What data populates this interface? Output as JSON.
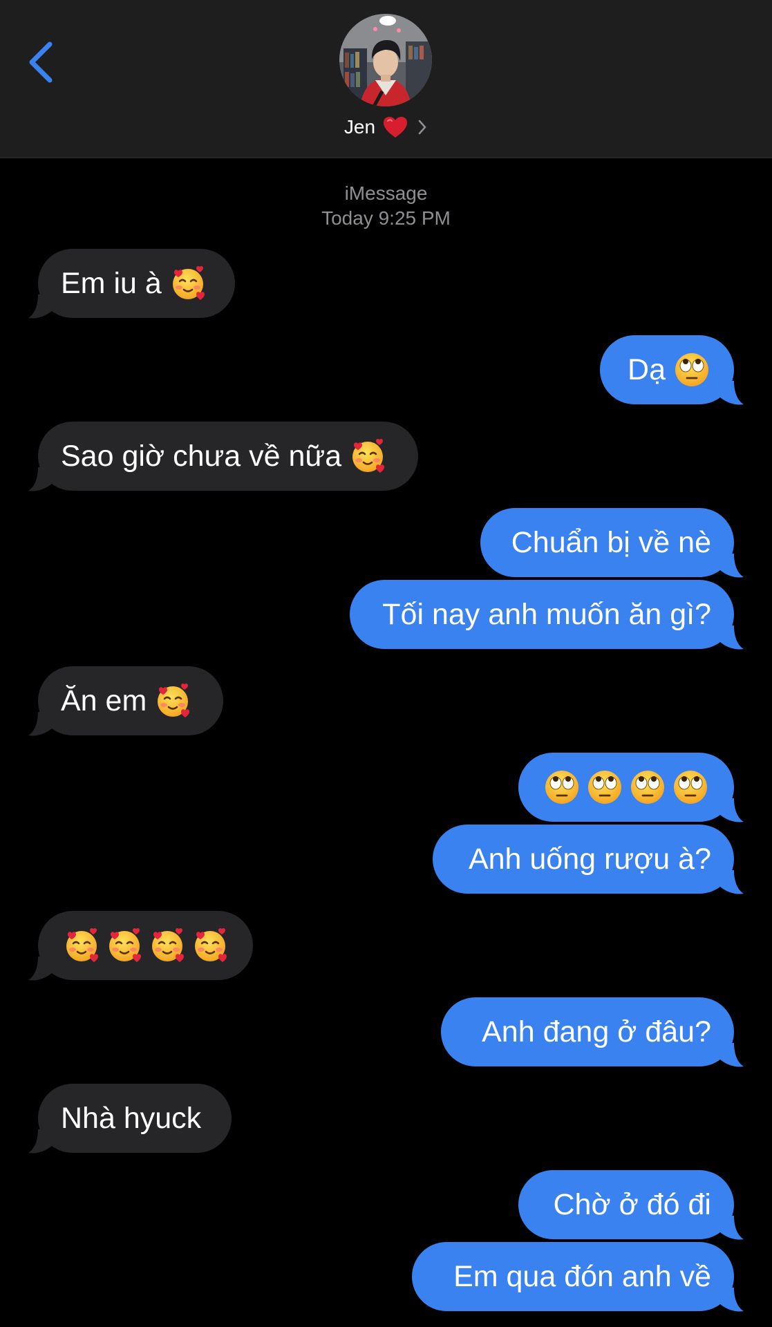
{
  "header": {
    "contact_name": "Jen",
    "heart_icon": "red-heart-icon",
    "chevron_icon": "chevron-right-icon",
    "back_icon": "chevron-left-icon",
    "accent_color": "#3b82f1"
  },
  "thread": {
    "service": "iMessage",
    "timestamp": "Today 9:25 PM"
  },
  "messages": [
    {
      "direction": "incoming",
      "text": "Em iu à",
      "emoji": [
        "smiling-face-with-hearts"
      ]
    },
    {
      "direction": "outgoing",
      "text": "Dạ",
      "emoji": [
        "face-with-rolling-eyes"
      ]
    },
    {
      "direction": "incoming",
      "text": "Sao giờ chưa về nữa",
      "emoji": [
        "smiling-face-with-hearts"
      ]
    },
    {
      "direction": "outgoing",
      "text": "Chuẩn bị về nè",
      "emoji": []
    },
    {
      "direction": "outgoing",
      "text": "Tối nay anh muốn ăn gì?",
      "emoji": []
    },
    {
      "direction": "incoming",
      "text": "Ăn em",
      "emoji": [
        "smiling-face-with-hearts"
      ]
    },
    {
      "direction": "outgoing",
      "text": "",
      "emoji": [
        "face-with-rolling-eyes",
        "face-with-rolling-eyes",
        "face-with-rolling-eyes",
        "face-with-rolling-eyes"
      ]
    },
    {
      "direction": "outgoing",
      "text": "Anh uống rượu à?",
      "emoji": []
    },
    {
      "direction": "incoming",
      "text": "",
      "emoji": [
        "smiling-face-with-hearts",
        "smiling-face-with-hearts",
        "smiling-face-with-hearts",
        "smiling-face-with-hearts"
      ]
    },
    {
      "direction": "outgoing",
      "text": "Anh đang ở đâu?",
      "emoji": []
    },
    {
      "direction": "incoming",
      "text": "Nhà hyuck",
      "emoji": []
    },
    {
      "direction": "outgoing",
      "text": "Chờ ở đó đi",
      "emoji": []
    },
    {
      "direction": "outgoing",
      "text": "Em qua đón anh về",
      "emoji": []
    }
  ],
  "colors": {
    "incoming_bubble": "#262628",
    "outgoing_bubble": "#3b82f1",
    "header_bg": "#1e1e1e",
    "meta_text": "#8e8e93"
  }
}
